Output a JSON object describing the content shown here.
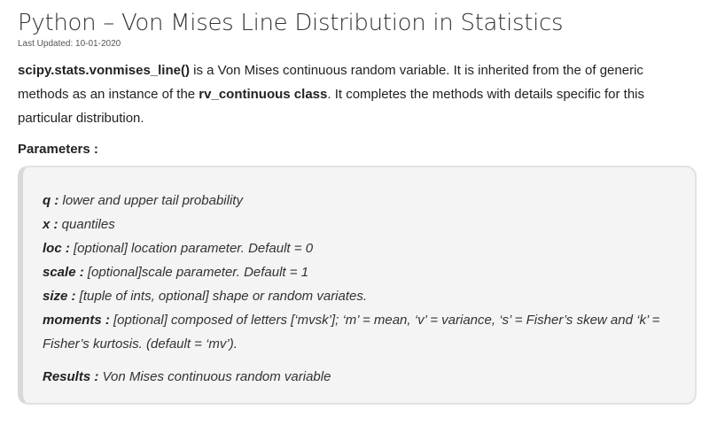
{
  "article": {
    "title": "Python – Von Mises Line Distribution in Statistics",
    "last_updated": "Last Updated: 10-01-2020",
    "intro": {
      "func_name": "scipy.stats.vonmises_line()",
      "text1": " is a Von Mises continuous random variable. It is inherited from the of generic methods as an instance of the ",
      "class_name": "rv_continuous class",
      "text2": ". It completes the methods with details specific for this particular distribution."
    },
    "parameters_heading": "Parameters :"
  },
  "params": [
    {
      "key": "q :",
      "desc": " lower and upper tail probability"
    },
    {
      "key": "x :",
      "desc": " quantiles"
    },
    {
      "key": "loc :",
      "desc": " [optional] location parameter. Default = 0"
    },
    {
      "key": "scale :",
      "desc": " [optional]scale parameter. Default = 1"
    },
    {
      "key": "size :",
      "desc": " [tuple of ints, optional] shape or random variates."
    },
    {
      "key": "moments :",
      "desc": " [optional] composed of letters [‘mvsk’]; ‘m’ = mean, ‘v’ = variance, ‘s’ = Fisher’s skew and ‘k’ = Fisher’s kurtosis. (default = ‘mv’)."
    }
  ],
  "results": {
    "key": "Results :",
    "desc": " Von Mises continuous random variable"
  }
}
